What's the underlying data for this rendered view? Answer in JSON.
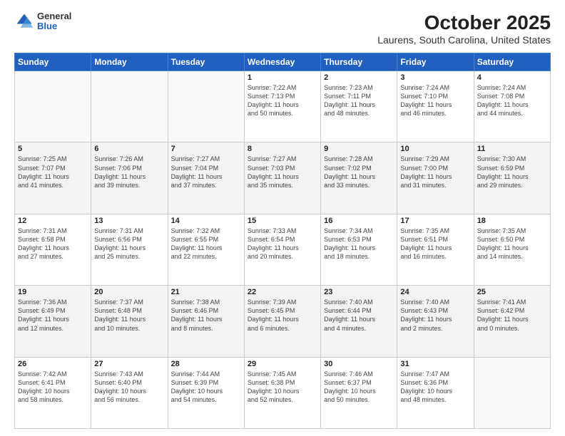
{
  "logo": {
    "general": "General",
    "blue": "Blue"
  },
  "title": "October 2025",
  "subtitle": "Laurens, South Carolina, United States",
  "headers": [
    "Sunday",
    "Monday",
    "Tuesday",
    "Wednesday",
    "Thursday",
    "Friday",
    "Saturday"
  ],
  "weeks": [
    [
      {
        "day": "",
        "info": ""
      },
      {
        "day": "",
        "info": ""
      },
      {
        "day": "",
        "info": ""
      },
      {
        "day": "1",
        "info": "Sunrise: 7:22 AM\nSunset: 7:13 PM\nDaylight: 11 hours\nand 50 minutes."
      },
      {
        "day": "2",
        "info": "Sunrise: 7:23 AM\nSunset: 7:11 PM\nDaylight: 11 hours\nand 48 minutes."
      },
      {
        "day": "3",
        "info": "Sunrise: 7:24 AM\nSunset: 7:10 PM\nDaylight: 11 hours\nand 46 minutes."
      },
      {
        "day": "4",
        "info": "Sunrise: 7:24 AM\nSunset: 7:08 PM\nDaylight: 11 hours\nand 44 minutes."
      }
    ],
    [
      {
        "day": "5",
        "info": "Sunrise: 7:25 AM\nSunset: 7:07 PM\nDaylight: 11 hours\nand 41 minutes."
      },
      {
        "day": "6",
        "info": "Sunrise: 7:26 AM\nSunset: 7:06 PM\nDaylight: 11 hours\nand 39 minutes."
      },
      {
        "day": "7",
        "info": "Sunrise: 7:27 AM\nSunset: 7:04 PM\nDaylight: 11 hours\nand 37 minutes."
      },
      {
        "day": "8",
        "info": "Sunrise: 7:27 AM\nSunset: 7:03 PM\nDaylight: 11 hours\nand 35 minutes."
      },
      {
        "day": "9",
        "info": "Sunrise: 7:28 AM\nSunset: 7:02 PM\nDaylight: 11 hours\nand 33 minutes."
      },
      {
        "day": "10",
        "info": "Sunrise: 7:29 AM\nSunset: 7:00 PM\nDaylight: 11 hours\nand 31 minutes."
      },
      {
        "day": "11",
        "info": "Sunrise: 7:30 AM\nSunset: 6:59 PM\nDaylight: 11 hours\nand 29 minutes."
      }
    ],
    [
      {
        "day": "12",
        "info": "Sunrise: 7:31 AM\nSunset: 6:58 PM\nDaylight: 11 hours\nand 27 minutes."
      },
      {
        "day": "13",
        "info": "Sunrise: 7:31 AM\nSunset: 6:56 PM\nDaylight: 11 hours\nand 25 minutes."
      },
      {
        "day": "14",
        "info": "Sunrise: 7:32 AM\nSunset: 6:55 PM\nDaylight: 11 hours\nand 22 minutes."
      },
      {
        "day": "15",
        "info": "Sunrise: 7:33 AM\nSunset: 6:54 PM\nDaylight: 11 hours\nand 20 minutes."
      },
      {
        "day": "16",
        "info": "Sunrise: 7:34 AM\nSunset: 6:53 PM\nDaylight: 11 hours\nand 18 minutes."
      },
      {
        "day": "17",
        "info": "Sunrise: 7:35 AM\nSunset: 6:51 PM\nDaylight: 11 hours\nand 16 minutes."
      },
      {
        "day": "18",
        "info": "Sunrise: 7:35 AM\nSunset: 6:50 PM\nDaylight: 11 hours\nand 14 minutes."
      }
    ],
    [
      {
        "day": "19",
        "info": "Sunrise: 7:36 AM\nSunset: 6:49 PM\nDaylight: 11 hours\nand 12 minutes."
      },
      {
        "day": "20",
        "info": "Sunrise: 7:37 AM\nSunset: 6:48 PM\nDaylight: 11 hours\nand 10 minutes."
      },
      {
        "day": "21",
        "info": "Sunrise: 7:38 AM\nSunset: 6:46 PM\nDaylight: 11 hours\nand 8 minutes."
      },
      {
        "day": "22",
        "info": "Sunrise: 7:39 AM\nSunset: 6:45 PM\nDaylight: 11 hours\nand 6 minutes."
      },
      {
        "day": "23",
        "info": "Sunrise: 7:40 AM\nSunset: 6:44 PM\nDaylight: 11 hours\nand 4 minutes."
      },
      {
        "day": "24",
        "info": "Sunrise: 7:40 AM\nSunset: 6:43 PM\nDaylight: 11 hours\nand 2 minutes."
      },
      {
        "day": "25",
        "info": "Sunrise: 7:41 AM\nSunset: 6:42 PM\nDaylight: 11 hours\nand 0 minutes."
      }
    ],
    [
      {
        "day": "26",
        "info": "Sunrise: 7:42 AM\nSunset: 6:41 PM\nDaylight: 10 hours\nand 58 minutes."
      },
      {
        "day": "27",
        "info": "Sunrise: 7:43 AM\nSunset: 6:40 PM\nDaylight: 10 hours\nand 56 minutes."
      },
      {
        "day": "28",
        "info": "Sunrise: 7:44 AM\nSunset: 6:39 PM\nDaylight: 10 hours\nand 54 minutes."
      },
      {
        "day": "29",
        "info": "Sunrise: 7:45 AM\nSunset: 6:38 PM\nDaylight: 10 hours\nand 52 minutes."
      },
      {
        "day": "30",
        "info": "Sunrise: 7:46 AM\nSunset: 6:37 PM\nDaylight: 10 hours\nand 50 minutes."
      },
      {
        "day": "31",
        "info": "Sunrise: 7:47 AM\nSunset: 6:36 PM\nDaylight: 10 hours\nand 48 minutes."
      },
      {
        "day": "",
        "info": ""
      }
    ]
  ]
}
